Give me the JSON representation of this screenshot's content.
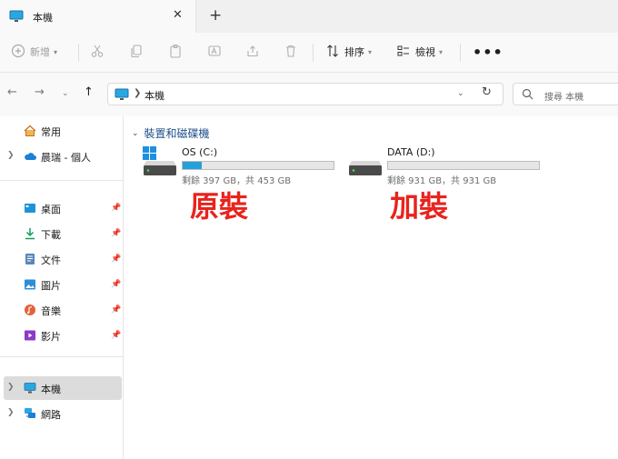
{
  "window": {
    "tab_title": "本機",
    "tab_close": "✕",
    "new_tab": "+"
  },
  "toolbar": {
    "new_label": "新增",
    "sort_label": "排序",
    "view_label": "檢視",
    "more": "•••"
  },
  "address": {
    "crumb": "本機"
  },
  "search": {
    "placeholder": "搜尋 本機"
  },
  "sidebar": {
    "items": [
      {
        "label": "常用",
        "icon": "home-icon"
      },
      {
        "label": "晨瑞 - 個人",
        "icon": "cloud-icon"
      },
      {
        "label": "桌面",
        "icon": "desktop-icon"
      },
      {
        "label": "下載",
        "icon": "download-icon"
      },
      {
        "label": "文件",
        "icon": "document-icon"
      },
      {
        "label": "圖片",
        "icon": "pictures-icon"
      },
      {
        "label": "音樂",
        "icon": "music-icon"
      },
      {
        "label": "影片",
        "icon": "video-icon"
      },
      {
        "label": "本機",
        "icon": "this-pc-icon"
      },
      {
        "label": "網路",
        "icon": "network-icon"
      }
    ]
  },
  "content": {
    "group_title": "裝置和磁碟機",
    "drives": [
      {
        "name": "OS (C:)",
        "info": "剩餘 397 GB，共 453 GB",
        "used_fraction": 0.124,
        "annotation": "原裝"
      },
      {
        "name": "DATA (D:)",
        "info": "剩餘 931 GB，共 931 GB",
        "used_fraction": 0.0,
        "annotation": "加裝"
      }
    ]
  },
  "colors": {
    "accent": "#26a0da",
    "annotation": "#e8231d",
    "group_header": "#1f4f8a"
  }
}
